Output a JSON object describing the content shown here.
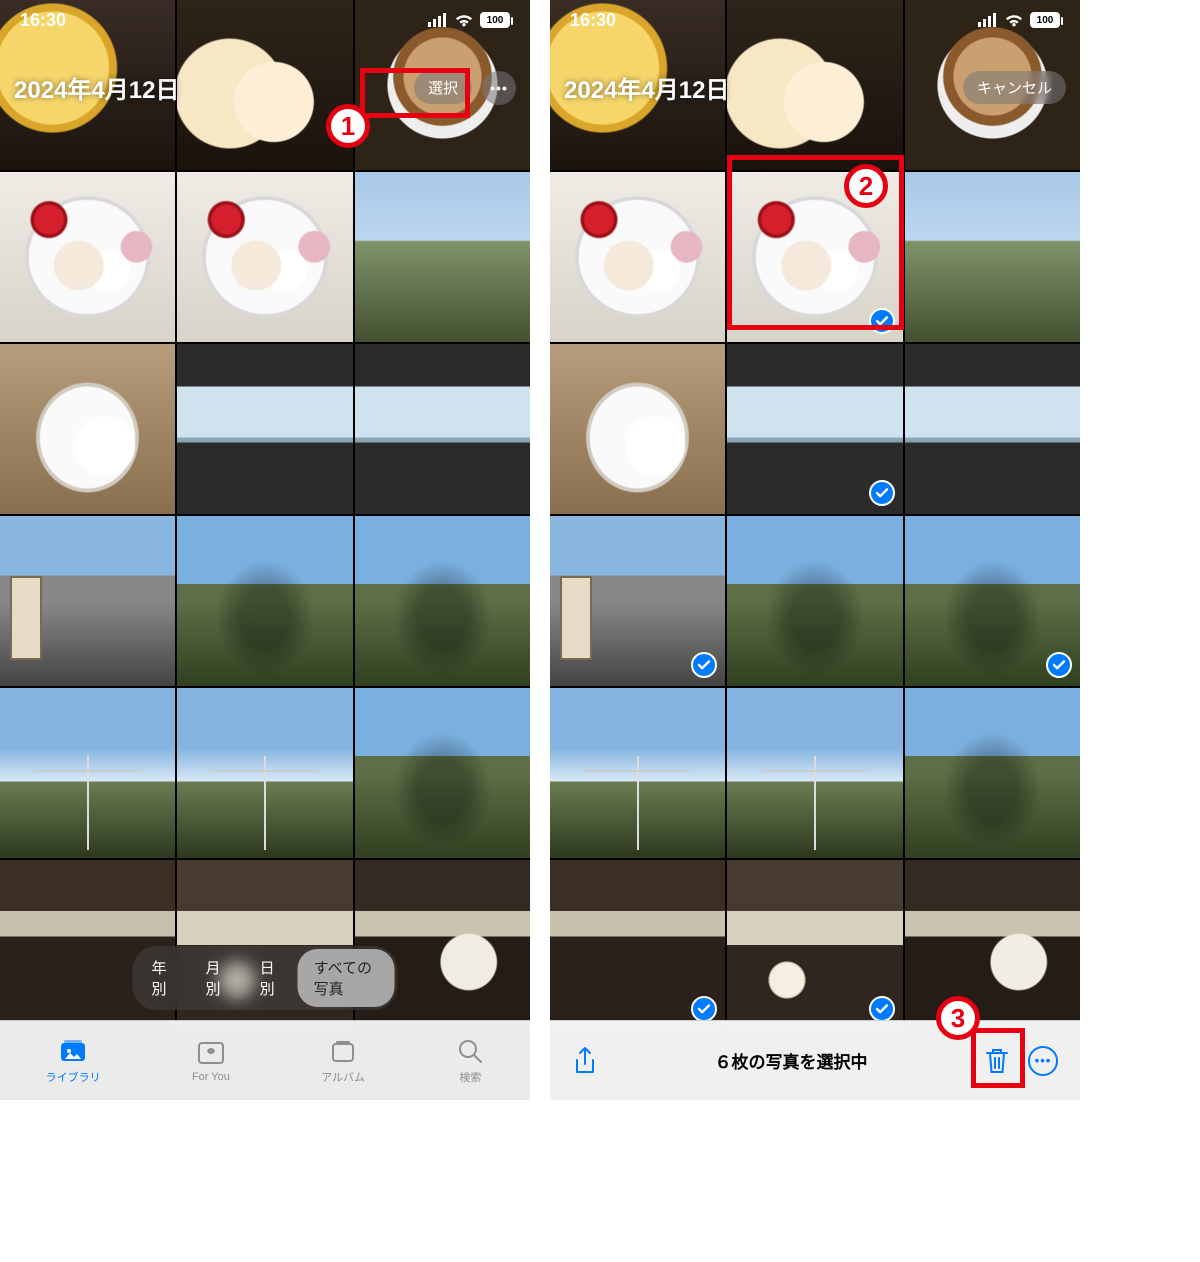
{
  "status": {
    "time": "16:30",
    "battery": "100"
  },
  "left": {
    "title": "2024年4月12日",
    "select_label": "選択",
    "seg": {
      "year": "年別",
      "month": "月別",
      "day": "日別",
      "all": "すべての写真"
    },
    "tabs": {
      "library": "ライブラリ",
      "foryou": "For You",
      "albums": "アルバム",
      "search": "検索"
    }
  },
  "right": {
    "title": "2024年4月12日",
    "cancel_label": "キャンセル",
    "status_text": "６枚の写真を選択中"
  },
  "annotations": {
    "n1": "1",
    "n2": "2",
    "n3": "3"
  }
}
